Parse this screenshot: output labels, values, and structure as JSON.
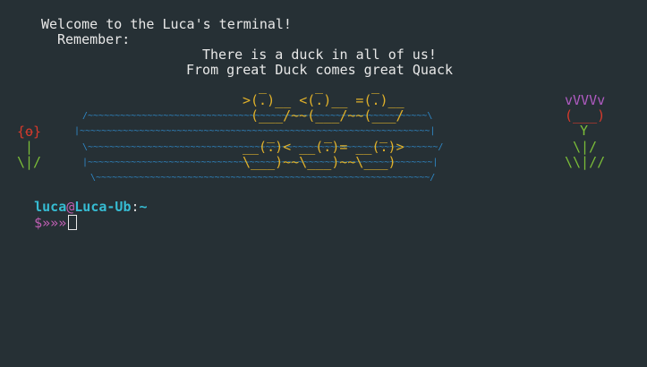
{
  "motd": {
    "welcome": "Welcome to the Luca's terminal!",
    "remember": "Remember:",
    "quote_line1": "There is a duck in all of us!",
    "quote_line2": "From great Duck comes great Quack"
  },
  "ascii_art": {
    "top_duck_heads": ">(.)__ <(.)__ =(.)__",
    "duck_hat": "_",
    "pond_top_edge": "/~~~~~~~~~~~~~~~~~~~~~~~~~~~~~~~~~~~~~~~~~~~~~~~~~~~~~~~~~~~~~~~\\",
    "top_duck_bodies": "(___/~~(___/~~(___/",
    "pond_row2": "|~~~~~~~~~~~~~~~~~~~~~~~~~~~~~~~~~~~~~~~~~~~~~~~~~~~~~~~~~~~~~~~~~|",
    "bottom_duck_heads": "__(.)< __(.)= __(.)>",
    "pond_row3": "\\~~~~~~~~~~~~~~~~~~~~~~~~~~~~~~~~~~~~~~~~~~~~~~~~~~~~~~~~~~~~~~~~~/",
    "bottom_duck_bodies": "\\___)~~\\___)~~\\___)",
    "pond_row4": "|~~~~~~~~~~~~~~~~~~~~~~~~~~~~~~~~~~~~~~~~~~~~~~~~~~~~~~~~~~~~~~~~|",
    "pond_bottom_edge": "\\~~~~~~~~~~~~~~~~~~~~~~~~~~~~~~~~~~~~~~~~~~~~~~~~~~~~~~~~~~~~~~/",
    "left_flower": [
      "_",
      "{o}",
      "|",
      "\\|/"
    ],
    "right_flower": [
      "vVVVv",
      "(___)",
      "Y",
      "\\|/",
      "\\\\|//"
    ]
  },
  "prompt": {
    "user": "luca",
    "at": "@",
    "host": "Luca-Ub",
    "colon": ":",
    "path": "~",
    "symbol": "$",
    "arrows": "»»»"
  },
  "colors": {
    "background": "#263035",
    "text": "#e8e8e8",
    "water": "#2f88c7",
    "ducks": "#e0b12a",
    "beaks": "#d83a2c",
    "stems": "#7cbf38",
    "tulip": "#b05bc2",
    "prompt_user": "#36bcd3",
    "prompt_at": "#c05fb4"
  }
}
